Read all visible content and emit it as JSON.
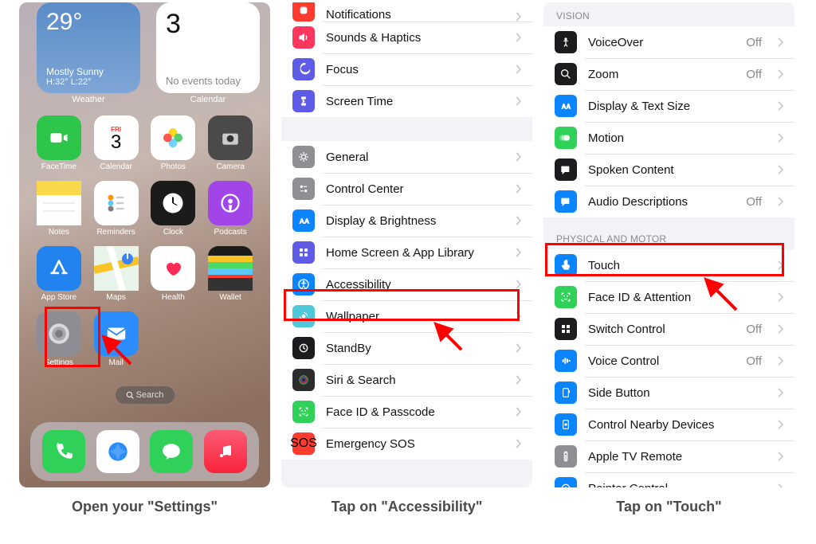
{
  "home": {
    "weather": {
      "temp": "29°",
      "desc": "Mostly Sunny",
      "hl": "H:32° L:22°",
      "label": "Weather"
    },
    "calendar": {
      "date": "3",
      "events": "No events today",
      "label": "Calendar"
    },
    "apps": [
      {
        "name": "FaceTime",
        "bg": "#2ec64a"
      },
      {
        "name": "Calendar",
        "bg": "#ffffff"
      },
      {
        "name": "Photos",
        "bg": "#ffffff"
      },
      {
        "name": "Camera",
        "bg": "#4a4a4a"
      },
      {
        "name": "Notes",
        "bg": "#f9e990"
      },
      {
        "name": "Reminders",
        "bg": "#ffffff"
      },
      {
        "name": "Clock",
        "bg": "#1b1b1b"
      },
      {
        "name": "Podcasts",
        "bg": "#a144e8"
      },
      {
        "name": "App Store",
        "bg": "#2282f0"
      },
      {
        "name": "Maps",
        "bg": "#ffffff"
      },
      {
        "name": "Health",
        "bg": "#ffffff"
      },
      {
        "name": "Wallet",
        "bg": "#1b1b1b"
      },
      {
        "name": "Settings",
        "bg": "#8d8d93"
      },
      {
        "name": "Mail",
        "bg": "#2b8cfc"
      }
    ],
    "cal_badge": "FRI",
    "cal_day": "3",
    "search": "Search"
  },
  "settings1": {
    "group1": [
      {
        "label": "Notifications",
        "key": "notifications",
        "bg": "#ff3b30"
      },
      {
        "label": "Sounds & Haptics",
        "key": "sounds",
        "bg": "#ff375f"
      },
      {
        "label": "Focus",
        "key": "focus",
        "bg": "#5e5ce6"
      },
      {
        "label": "Screen Time",
        "key": "screentime",
        "bg": "#5e5ce6"
      }
    ],
    "group2": [
      {
        "label": "General",
        "key": "general",
        "bg": "#8e8e93"
      },
      {
        "label": "Control Center",
        "key": "controlcenter",
        "bg": "#8e8e93"
      },
      {
        "label": "Display & Brightness",
        "key": "display",
        "bg": "#0a84ff"
      },
      {
        "label": "Home Screen & App Library",
        "key": "homescreen",
        "bg": "#5e5ce6"
      },
      {
        "label": "Accessibility",
        "key": "accessibility",
        "bg": "#0a84ff"
      },
      {
        "label": "Wallpaper",
        "key": "wallpaper",
        "bg": "#4fc9d9"
      },
      {
        "label": "StandBy",
        "key": "standby",
        "bg": "#1c1c1e"
      },
      {
        "label": "Siri & Search",
        "key": "siri",
        "bg": "#2c2c2e"
      },
      {
        "label": "Face ID & Passcode",
        "key": "faceid",
        "bg": "#30d158"
      },
      {
        "label": "Emergency SOS",
        "key": "sos",
        "bg": "#ff3b30"
      }
    ]
  },
  "settings2": {
    "header1": "VISION",
    "group1": [
      {
        "label": "VoiceOver",
        "key": "voiceover",
        "bg": "#1c1c1e",
        "value": "Off"
      },
      {
        "label": "Zoom",
        "key": "zoom",
        "bg": "#1c1c1e",
        "value": "Off"
      },
      {
        "label": "Display & Text Size",
        "key": "displaytext",
        "bg": "#0a84ff"
      },
      {
        "label": "Motion",
        "key": "motion",
        "bg": "#30d158"
      },
      {
        "label": "Spoken Content",
        "key": "spoken",
        "bg": "#1c1c1e"
      },
      {
        "label": "Audio Descriptions",
        "key": "audiodesc",
        "bg": "#0a84ff",
        "value": "Off"
      }
    ],
    "header2": "PHYSICAL AND MOTOR",
    "group2": [
      {
        "label": "Touch",
        "key": "touch",
        "bg": "#0a84ff"
      },
      {
        "label": "Face ID & Attention",
        "key": "faceidatt",
        "bg": "#30d158"
      },
      {
        "label": "Switch Control",
        "key": "switchcontrol",
        "bg": "#1c1c1e",
        "value": "Off"
      },
      {
        "label": "Voice Control",
        "key": "voicecontrol",
        "bg": "#0a84ff",
        "value": "Off"
      },
      {
        "label": "Side Button",
        "key": "sidebutton",
        "bg": "#0a84ff"
      },
      {
        "label": "Control Nearby Devices",
        "key": "nearby",
        "bg": "#0a84ff"
      },
      {
        "label": "Apple TV Remote",
        "key": "atvremote",
        "bg": "#8e8e93"
      },
      {
        "label": "Pointer Control",
        "key": "pointer",
        "bg": "#0a84ff"
      }
    ]
  },
  "captions": [
    "Open your \"Settings\"",
    "Tap on \"Accessibility\"",
    "Tap on \"Touch\""
  ]
}
